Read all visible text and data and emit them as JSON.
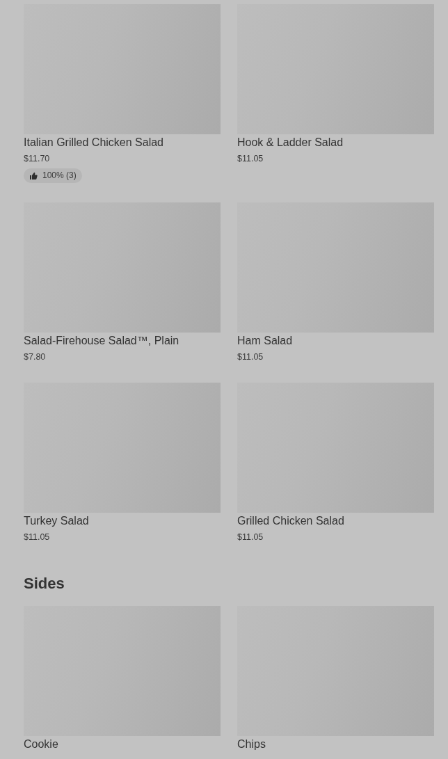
{
  "sections": [
    {
      "items": [
        {
          "name": "Italian Grilled Chicken Salad",
          "price": "$11.70",
          "rating": "100% (3)"
        },
        {
          "name": "Hook & Ladder Salad",
          "price": "$11.05"
        },
        {
          "name": "Salad-Firehouse Salad™, Plain",
          "price": "$7.80"
        },
        {
          "name": "Ham Salad",
          "price": "$11.05"
        },
        {
          "name": "Turkey Salad",
          "price": "$11.05"
        },
        {
          "name": "Grilled Chicken Salad",
          "price": "$11.05"
        }
      ]
    },
    {
      "title": "Sides",
      "items": [
        {
          "name": "Cookie"
        },
        {
          "name": "Chips"
        }
      ]
    }
  ]
}
